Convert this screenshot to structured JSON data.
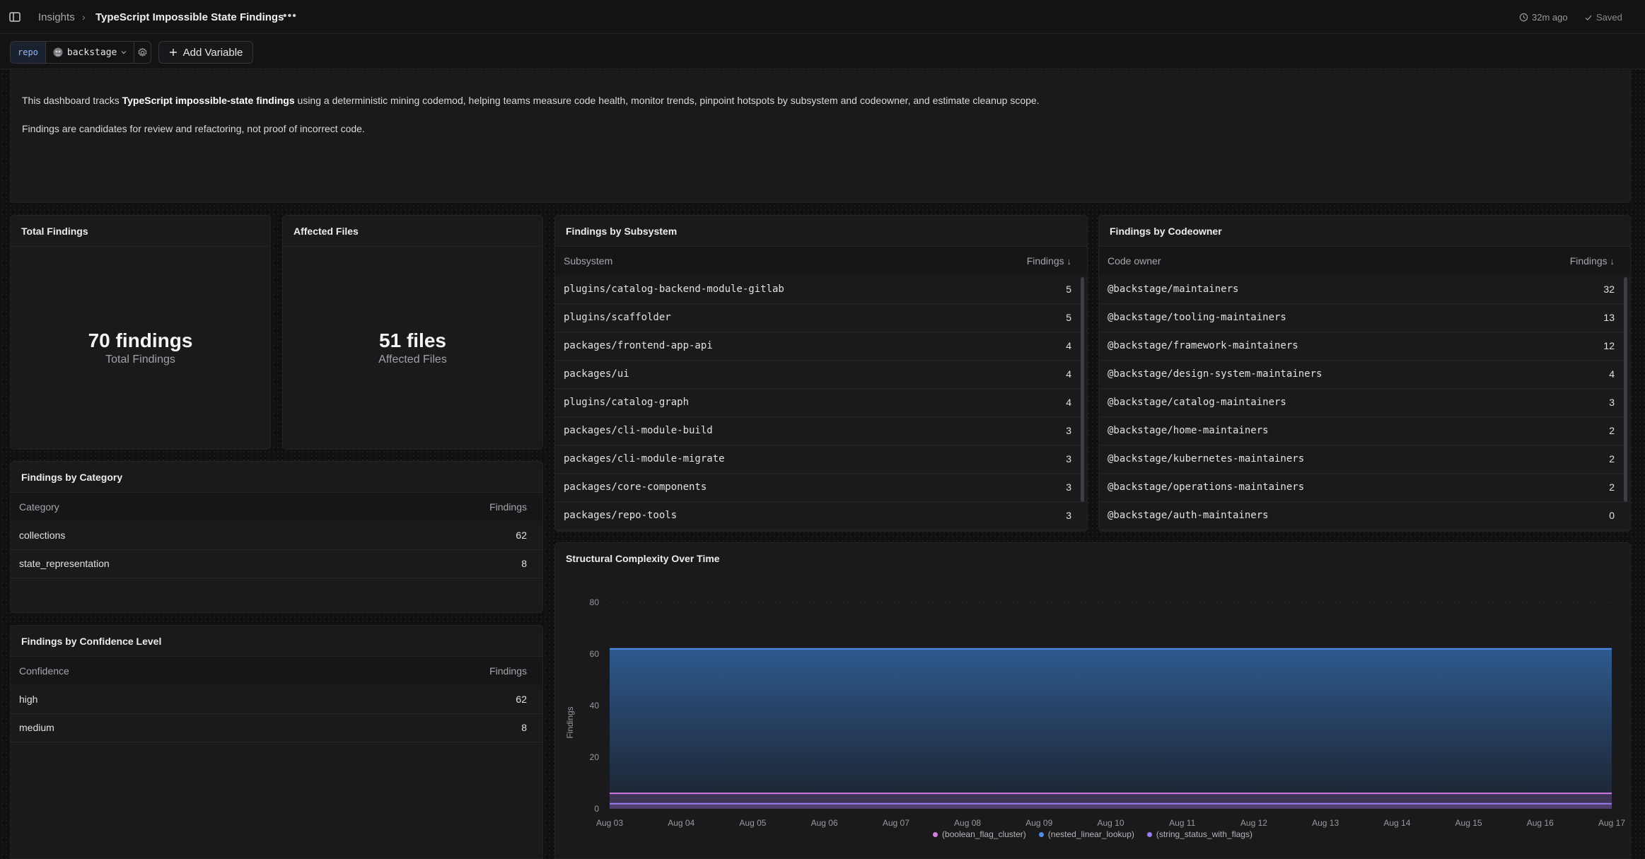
{
  "topbar": {
    "breadcrumb_root": "Insights",
    "breadcrumb_sep": "›",
    "title": "TypeScript Impossible State Findings",
    "more": "•••",
    "time_ago": "32m ago",
    "saved": "Saved"
  },
  "variables": {
    "key": "repo",
    "value": "backstage",
    "add_label": "Add Variable"
  },
  "intro": {
    "line1_prefix": "This dashboard tracks ",
    "line1_bold": "TypeScript impossible-state findings",
    "line1_suffix": " using a deterministic mining codemod, helping teams measure code health, monitor trends, pinpoint hotspots by subsystem and codeowner, and estimate cleanup scope.",
    "line2": "Findings are candidates for review and refactoring, not proof of incorrect code."
  },
  "total_findings": {
    "title": "Total Findings",
    "value": "70 findings",
    "label": "Total Findings"
  },
  "affected_files": {
    "title": "Affected Files",
    "value": "51 files",
    "label": "Affected Files"
  },
  "by_subsystem": {
    "title": "Findings by Subsystem",
    "col1": "Subsystem",
    "col2": "Findings",
    "rows": [
      {
        "name": "plugins/catalog-backend-module-gitlab",
        "count": "5"
      },
      {
        "name": "plugins/scaffolder",
        "count": "5"
      },
      {
        "name": "packages/frontend-app-api",
        "count": "4"
      },
      {
        "name": "packages/ui",
        "count": "4"
      },
      {
        "name": "plugins/catalog-graph",
        "count": "4"
      },
      {
        "name": "packages/cli-module-build",
        "count": "3"
      },
      {
        "name": "packages/cli-module-migrate",
        "count": "3"
      },
      {
        "name": "packages/core-components",
        "count": "3"
      },
      {
        "name": "packages/repo-tools",
        "count": "3"
      }
    ]
  },
  "by_codeowner": {
    "title": "Findings by Codeowner",
    "col1": "Code owner",
    "col2": "Findings",
    "rows": [
      {
        "name": "@backstage/maintainers",
        "count": "32"
      },
      {
        "name": "@backstage/tooling-maintainers",
        "count": "13"
      },
      {
        "name": "@backstage/framework-maintainers",
        "count": "12"
      },
      {
        "name": "@backstage/design-system-maintainers",
        "count": "4"
      },
      {
        "name": "@backstage/catalog-maintainers",
        "count": "3"
      },
      {
        "name": "@backstage/home-maintainers",
        "count": "2"
      },
      {
        "name": "@backstage/kubernetes-maintainers",
        "count": "2"
      },
      {
        "name": "@backstage/operations-maintainers",
        "count": "2"
      },
      {
        "name": "@backstage/auth-maintainers",
        "count": "0"
      }
    ]
  },
  "by_category": {
    "title": "Findings by Category",
    "col1": "Category",
    "col2": "Findings",
    "rows": [
      {
        "name": "collections",
        "count": "62"
      },
      {
        "name": "state_representation",
        "count": "8"
      }
    ]
  },
  "by_confidence": {
    "title": "Findings by Confidence Level",
    "col1": "Confidence",
    "col2": "Findings",
    "rows": [
      {
        "name": "high",
        "count": "62"
      },
      {
        "name": "medium",
        "count": "8"
      }
    ]
  },
  "chart_data": {
    "type": "area",
    "title": "Structural Complexity Over Time",
    "xlabel": "",
    "ylabel": "Findings",
    "ylim": [
      0,
      80
    ],
    "yticks": [
      0,
      20,
      40,
      60,
      80
    ],
    "grid": true,
    "legend_position": "bottom",
    "categories": [
      "Aug 03",
      "Aug 04",
      "Aug 05",
      "Aug 06",
      "Aug 07",
      "Aug 08",
      "Aug 09",
      "Aug 10",
      "Aug 11",
      "Aug 12",
      "Aug 13",
      "Aug 14",
      "Aug 15",
      "Aug 16",
      "Aug 17"
    ],
    "series": [
      {
        "name": "(nested_linear_lookup)",
        "color": "#4d8fe8",
        "values": [
          62,
          62,
          62,
          62,
          62,
          62,
          62,
          62,
          62,
          62,
          62,
          62,
          62,
          62,
          62
        ]
      },
      {
        "name": "(boolean_flag_cluster)",
        "color": "#d77ae8",
        "values": [
          6,
          6,
          6,
          6,
          6,
          6,
          6,
          6,
          6,
          6,
          6,
          6,
          6,
          6,
          6
        ]
      },
      {
        "name": "(string_status_with_flags)",
        "color": "#9b7df0",
        "values": [
          2,
          2,
          2,
          2,
          2,
          2,
          2,
          2,
          2,
          2,
          2,
          2,
          2,
          2,
          2
        ]
      }
    ],
    "legend_order": [
      "(boolean_flag_cluster)",
      "(nested_linear_lookup)",
      "(string_status_with_flags)"
    ]
  }
}
